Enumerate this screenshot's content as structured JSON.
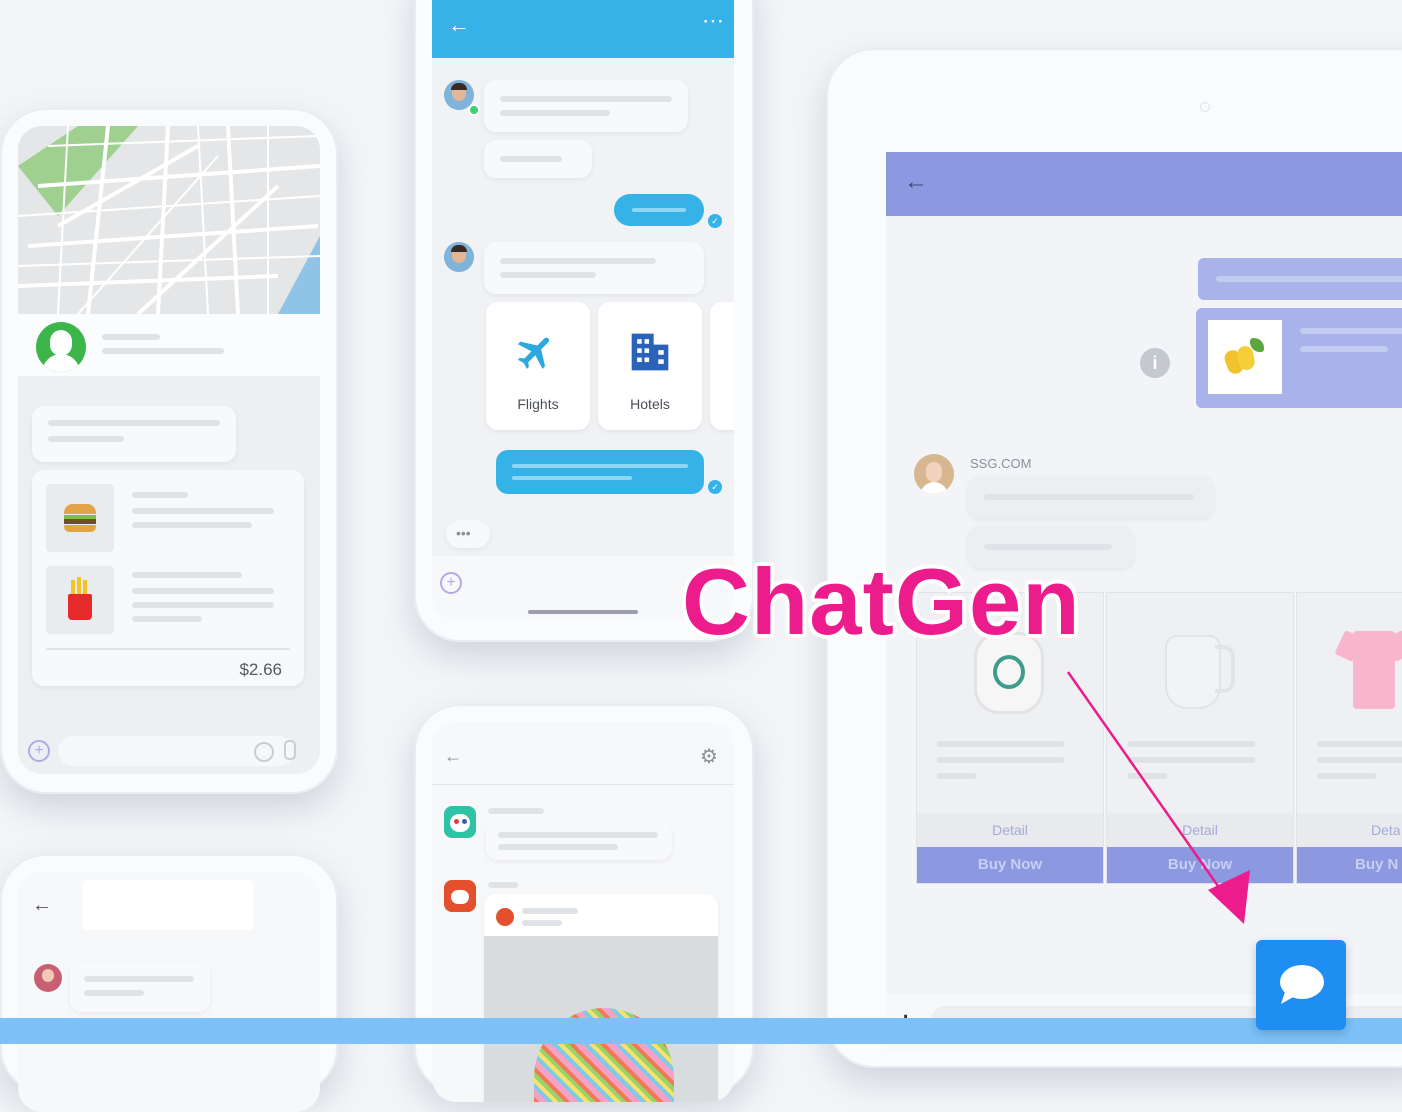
{
  "brand": {
    "name": "ChatGen",
    "accent": "#ec1c8c"
  },
  "phone_food": {
    "price": "$2.66"
  },
  "phone_travel": {
    "options": [
      {
        "label": "Flights",
        "icon": "plane-icon"
      },
      {
        "label": "Hotels",
        "icon": "building-icon"
      }
    ]
  },
  "tablet": {
    "sender": "SSG.COM",
    "products": [
      {
        "detail_label": "Detail",
        "buy_label": "Buy Now"
      },
      {
        "detail_label": "Detail",
        "buy_label": "Buy Now"
      },
      {
        "detail_label": "Deta",
        "buy_label": "Buy N"
      }
    ]
  },
  "colors": {
    "header_blue": "#35b3e8",
    "tablet_purple": "#8c98e0",
    "chat_button": "#1f8ef2",
    "bottom_bar": "#7cc1f7"
  }
}
